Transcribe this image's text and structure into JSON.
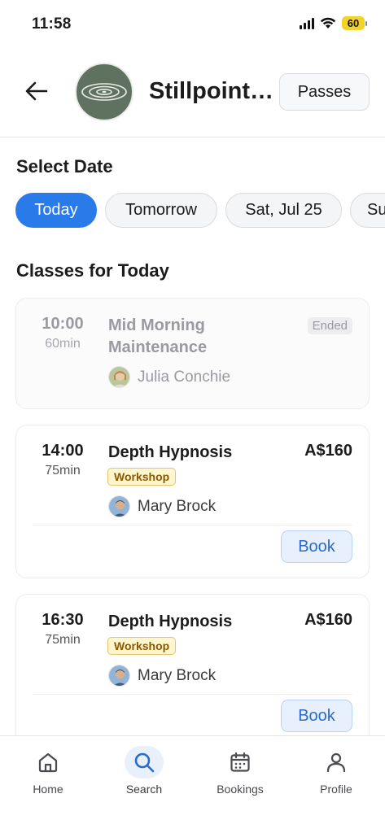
{
  "status_bar": {
    "time": "11:58",
    "battery": "60"
  },
  "header": {
    "studio_name": "Stillpoint…",
    "passes_label": "Passes"
  },
  "select_date": {
    "title": "Select Date",
    "chips": [
      {
        "label": "Today",
        "active": true
      },
      {
        "label": "Tomorrow",
        "active": false
      },
      {
        "label": "Sat, Jul 25",
        "active": false
      },
      {
        "label": "Su",
        "active": false
      }
    ]
  },
  "classes": {
    "title": "Classes for Today",
    "items": [
      {
        "time": "10:00",
        "duration": "60min",
        "name": "Mid Morning Maintenance",
        "status": "Ended",
        "instructor": "Julia Conchie"
      },
      {
        "time": "14:00",
        "duration": "75min",
        "name": "Depth Hypnosis",
        "price": "A$160",
        "tag": "Workshop",
        "instructor": "Mary Brock",
        "action": "Book"
      },
      {
        "time": "16:30",
        "duration": "75min",
        "name": "Depth Hypnosis",
        "price": "A$160",
        "tag": "Workshop",
        "instructor": "Mary Brock",
        "action": "Book"
      }
    ]
  },
  "tab_bar": {
    "tabs": [
      {
        "label": "Home",
        "icon": "home-icon"
      },
      {
        "label": "Search",
        "icon": "search-icon",
        "active": true
      },
      {
        "label": "Bookings",
        "icon": "calendar-icon"
      },
      {
        "label": "Profile",
        "icon": "user-icon"
      }
    ]
  },
  "colors": {
    "accent": "#2a7bea",
    "logo_bg": "#5f725f",
    "workshop_bg": "#fff5cf"
  }
}
